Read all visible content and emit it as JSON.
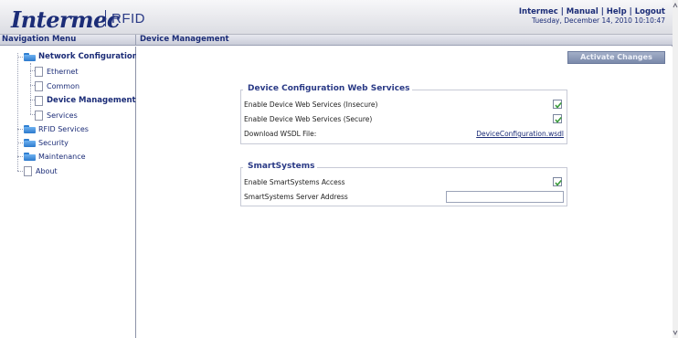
{
  "header": {
    "logo_text": "Intermec",
    "product": "RFID",
    "links": [
      "Intermec",
      "Manual",
      "Help",
      "Logout"
    ],
    "link_separator": " | ",
    "datetime": "Tuesday, December 14, 2010 10:10:47"
  },
  "titlebar": {
    "nav_title": "Navigation Menu",
    "page_title": "Device Management"
  },
  "nav": {
    "items": [
      {
        "label": "Network Configuration",
        "type": "folder",
        "bold": true
      },
      {
        "label": "Ethernet",
        "type": "page"
      },
      {
        "label": "Common",
        "type": "page"
      },
      {
        "label": "Device Management",
        "type": "page",
        "bold": true,
        "selected": true
      },
      {
        "label": "Services",
        "type": "page"
      },
      {
        "label": "RFID Services",
        "type": "folder"
      },
      {
        "label": "Security",
        "type": "folder"
      },
      {
        "label": "Maintenance",
        "type": "folder"
      },
      {
        "label": "About",
        "type": "page"
      }
    ]
  },
  "main": {
    "activate_label": "Activate Changes",
    "web_services": {
      "legend": "Device Configuration Web Services",
      "rows": [
        {
          "label": "Enable Device Web Services (Insecure)",
          "checked": true
        },
        {
          "label": "Enable Device Web Services (Secure)",
          "checked": true
        }
      ],
      "download_label": "Download WSDL File:",
      "wsdl_link": "DeviceConfiguration.wsdl"
    },
    "smartsystems": {
      "legend": "SmartSystems",
      "access_label": "Enable SmartSystems Access",
      "access_checked": true,
      "server_label": "SmartSystems Server Address",
      "server_value": ""
    }
  },
  "colors": {
    "brand": "#1b2c77",
    "check": "#3a9a3a",
    "folder": "#2f7fd1"
  },
  "icons": {
    "folder": "folder-icon",
    "page": "page-icon",
    "check": "checkmark-icon"
  }
}
